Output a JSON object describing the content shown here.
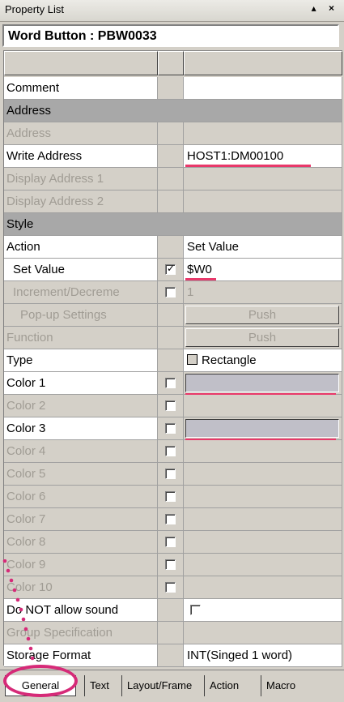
{
  "window": {
    "title": "Property List",
    "controls": "▴ ×"
  },
  "object_header": "Word Button : PBW0033",
  "rows": [
    {
      "label": "Comment",
      "value": ""
    },
    {
      "label": "Address"
    },
    {
      "label": "Address"
    },
    {
      "label": "Write Address",
      "value": "HOST1:DM00100"
    },
    {
      "label": "Display Address 1"
    },
    {
      "label": "Display Address 2"
    },
    {
      "label": "Style"
    },
    {
      "label": "Action",
      "value": "Set Value"
    },
    {
      "label": "Set Value",
      "value": "$W0"
    },
    {
      "label": "Increment/Decreme",
      "value": "1"
    },
    {
      "label": "Pop-up Settings",
      "value": "Push"
    },
    {
      "label": "Function",
      "value": "Push"
    },
    {
      "label": "Type",
      "value": "Rectangle"
    },
    {
      "label": "Color 1"
    },
    {
      "label": "Color 2"
    },
    {
      "label": "Color 3"
    },
    {
      "label": "Color 4"
    },
    {
      "label": "Color 5"
    },
    {
      "label": "Color 6"
    },
    {
      "label": "Color 7"
    },
    {
      "label": "Color 8"
    },
    {
      "label": "Color 9"
    },
    {
      "label": "Color 10"
    },
    {
      "label": "Do NOT allow sound"
    },
    {
      "label": "Group Specification"
    },
    {
      "label": "Storage Format",
      "value": "INT(Singed 1 word)"
    }
  ],
  "tabs": [
    "General",
    "Text",
    "Layout/Frame",
    "Action",
    "Macro"
  ],
  "colors": {
    "highlight": "#e8386a",
    "annotation_ring": "#d62a78",
    "section": "#a8a8a8"
  }
}
